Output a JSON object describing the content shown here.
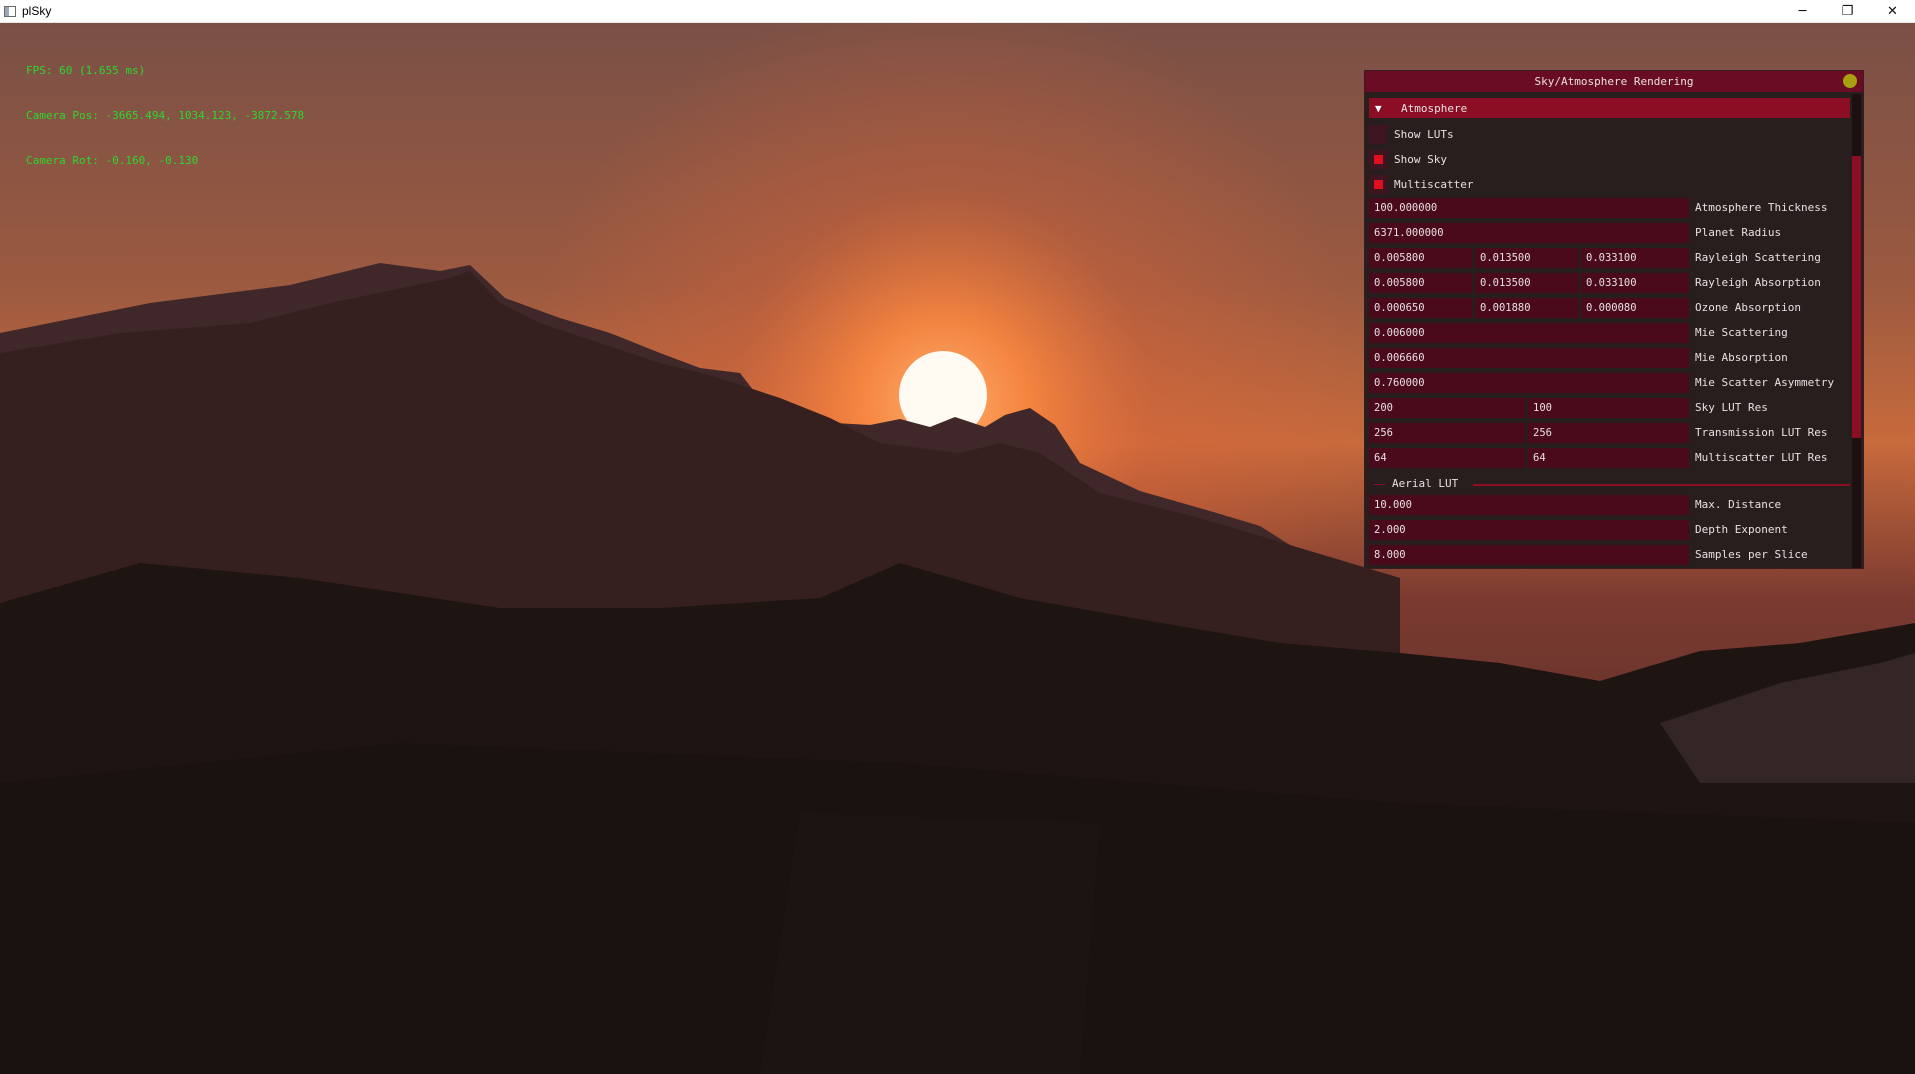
{
  "window": {
    "title": "plSky",
    "minimize": "─",
    "restore": "❐",
    "close": "✕",
    "icon": "app-icon"
  },
  "overlay": {
    "fps": "FPS: 60 (1.655 ms)",
    "camera_pos": "Camera Pos: -3665.494, 1034.123, -3872.578",
    "camera_rot": "Camera Rot: -0.160, -0.130"
  },
  "panel": {
    "title": "Sky/Atmosphere Rendering",
    "close_icon": "close-circle-icon",
    "atmosphere": {
      "label": "Atmosphere",
      "arrow": "▼",
      "show_luts": {
        "label": "Show LUTs",
        "checked": false
      },
      "show_sky": {
        "label": "Show Sky",
        "checked": true
      },
      "multiscatter": {
        "label": "Multiscatter",
        "checked": true
      },
      "atmosphere_thickness": {
        "label": "Atmosphere Thickness",
        "value": "100.000000"
      },
      "planet_radius": {
        "label": "Planet Radius",
        "value": "6371.000000"
      },
      "rayleigh_scattering": {
        "label": "Rayleigh Scattering",
        "values": [
          "0.005800",
          "0.013500",
          "0.033100"
        ]
      },
      "rayleigh_absorption": {
        "label": "Rayleigh Absorption",
        "values": [
          "0.005800",
          "0.013500",
          "0.033100"
        ]
      },
      "ozone_absorption": {
        "label": "Ozone Absorption",
        "values": [
          "0.000650",
          "0.001880",
          "0.000080"
        ]
      },
      "mie_scattering": {
        "label": "Mie Scattering",
        "value": "0.006000"
      },
      "mie_absorption": {
        "label": "Mie Absorption",
        "value": "0.006660"
      },
      "mie_scatter_asymmetry": {
        "label": "Mie Scatter Asymmetry",
        "value": "0.760000"
      },
      "sky_lut_res": {
        "label": "Sky LUT Res",
        "values": [
          "200",
          "100"
        ]
      },
      "transmission_lut_res": {
        "label": "Transmission LUT Res",
        "values": [
          "256",
          "256"
        ]
      },
      "multiscatter_lut_res": {
        "label": "Multiscatter LUT Res",
        "values": [
          "64",
          "64"
        ]
      }
    },
    "aerial": {
      "label": "Aerial LUT",
      "max_distance": {
        "label": "Max. Distance",
        "value": "10.000"
      },
      "depth_exponent": {
        "label": "Depth Exponent",
        "value": "2.000"
      },
      "samples_per_slice": {
        "label": "Samples per Slice",
        "value": "8.000"
      }
    }
  },
  "colors": {
    "title_bg": "#6a0c24",
    "header_bg": "#8c0e24",
    "field_bg": "#4a0a1c",
    "checkbox_on": "#e0101e",
    "overlay_text": "#2cd82c",
    "close_dot": "#a8a010"
  }
}
